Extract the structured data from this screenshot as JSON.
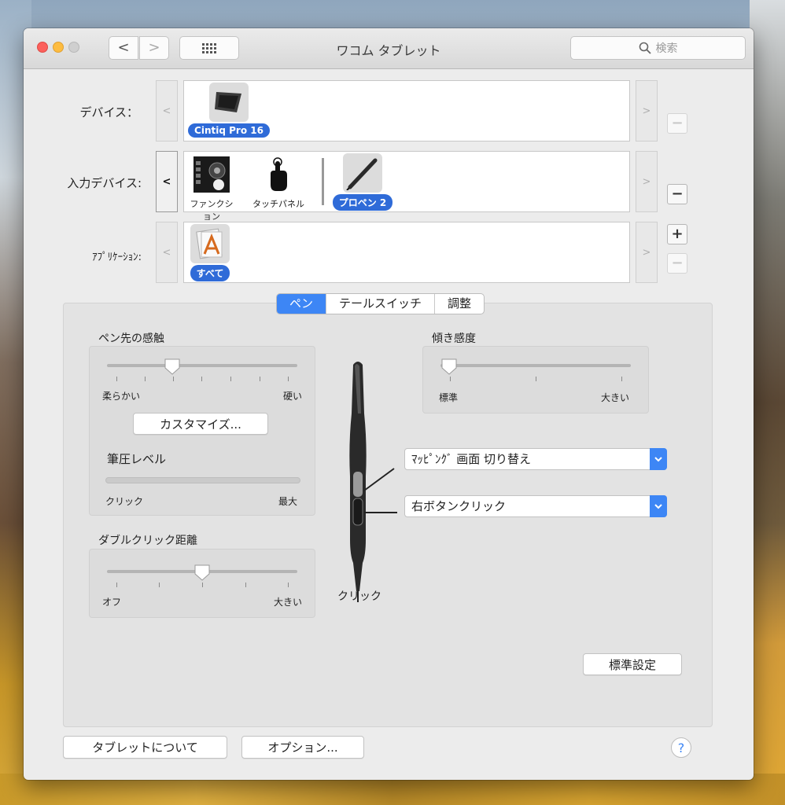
{
  "window": {
    "title": "ワコム タブレット"
  },
  "toolbar": {
    "back": "<",
    "forward": ">"
  },
  "search": {
    "placeholder": "検索"
  },
  "rows": {
    "device": {
      "label": "デバイス：",
      "items": [
        {
          "name": "Cintiq Pro 16"
        }
      ]
    },
    "input": {
      "label": "入力デバイス:",
      "items": [
        {
          "name": "ファンクション"
        },
        {
          "name": "タッチパネル"
        },
        {
          "name": "プロペン 2"
        }
      ]
    },
    "app": {
      "label": "ｱﾌﾟﾘｹｰｼｮﾝ:",
      "items": [
        {
          "name": "すべて"
        }
      ]
    }
  },
  "scroll": {
    "left": "<",
    "right": ">"
  },
  "side_buttons": {
    "minus": "−",
    "plus": "+"
  },
  "tabs": [
    "ペン",
    "テールスイッチ",
    "調整"
  ],
  "selected_tab": 0,
  "tip_feel": {
    "title": "ペン先の感触",
    "min_label": "柔らかい",
    "max_label": "硬い",
    "value_fraction": 0.35,
    "customize": "カスタマイズ...",
    "pressure_title": "筆圧レベル",
    "pressure_min": "クリック",
    "pressure_max": "最大",
    "pressure_value": 0
  },
  "double_click": {
    "title": "ダブルクリック距離",
    "min_label": "オフ",
    "max_label": "大きい",
    "value_fraction": 0.5
  },
  "tilt": {
    "title": "傾き感度",
    "min_label": "標準",
    "max_label": "大きい",
    "value_fraction": 0.0
  },
  "pen_buttons": {
    "upper": "ﾏｯﾋﾟﾝｸﾞ 画面 切り替え",
    "lower": "右ボタンクリック",
    "tip": "クリック"
  },
  "default_button": "標準設定",
  "footer": {
    "about": "タブレットについて",
    "options": "オプション...",
    "help": "?"
  },
  "colors": {
    "accent": "#3d86f5",
    "pill": "#2f6bd8"
  }
}
